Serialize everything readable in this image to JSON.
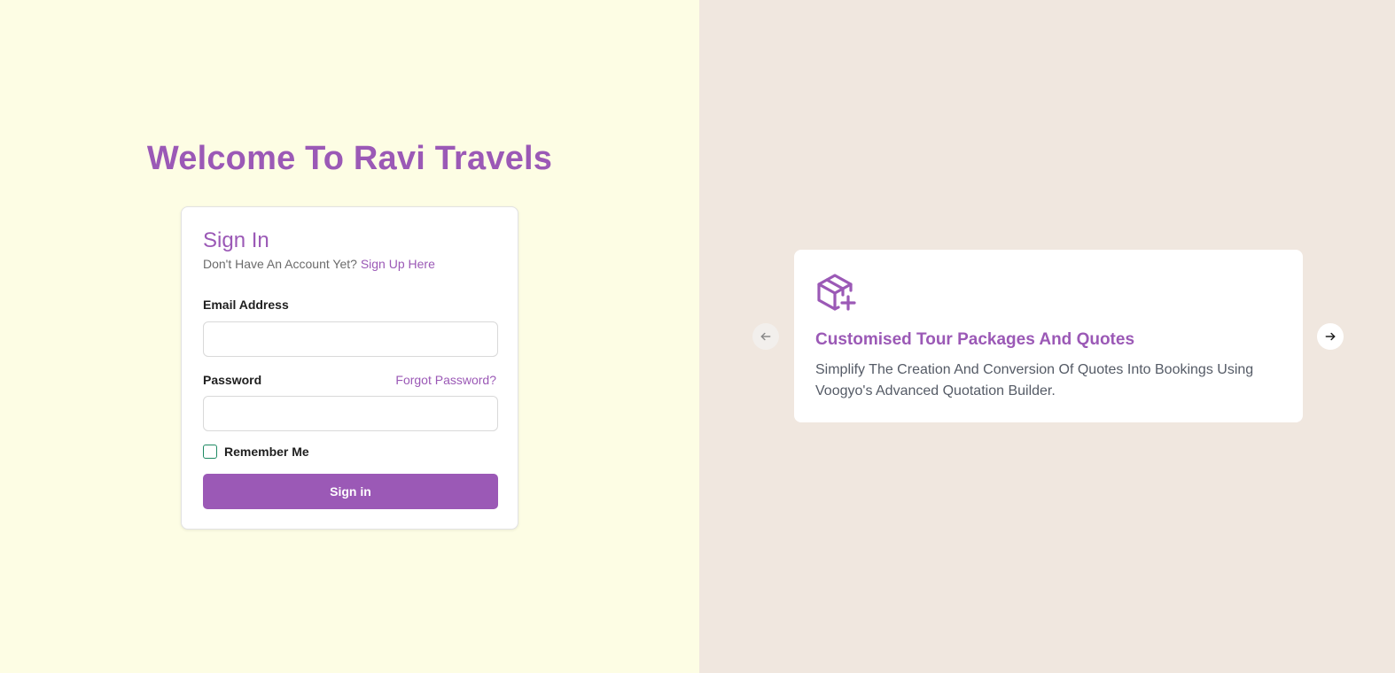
{
  "welcome": {
    "title": "Welcome To Ravi Travels"
  },
  "signin": {
    "title": "Sign In",
    "no_account_text": "Don't Have An Account Yet?",
    "signup_link": "Sign Up Here",
    "email_label": "Email Address",
    "email_value": "",
    "password_label": "Password",
    "password_value": "",
    "forgot_link": "Forgot Password?",
    "remember_label": "Remember Me",
    "remember_checked": false,
    "submit_label": "Sign in"
  },
  "carousel": {
    "prev_icon": "arrow-left-icon",
    "next_icon": "arrow-right-icon",
    "slide": {
      "icon": "package-plus-icon",
      "title": "Customised Tour Packages And Quotes",
      "description": "Simplify The Creation And Conversion Of Quotes Into Bookings Using Voogyo's Advanced Quotation Builder."
    }
  },
  "colors": {
    "accent": "#9b59b6",
    "left_background": "#fdfde4",
    "right_background": "#f0e7df",
    "checkbox_border": "#1e8a63"
  }
}
